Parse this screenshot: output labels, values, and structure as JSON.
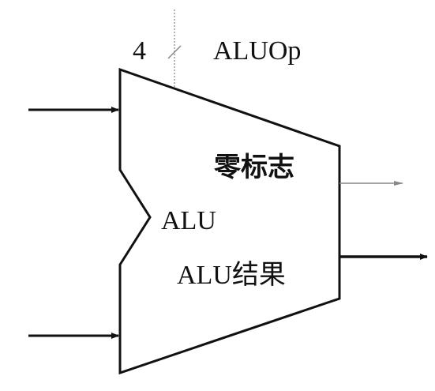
{
  "labels": {
    "control_width": "4",
    "control_signal": "ALUOp",
    "unit_name": "ALU",
    "zero_flag": "零标志",
    "result": "ALU结果"
  },
  "colors": {
    "stroke": "#111111",
    "thin_arrow": "#888888",
    "background": "#ffffff"
  }
}
